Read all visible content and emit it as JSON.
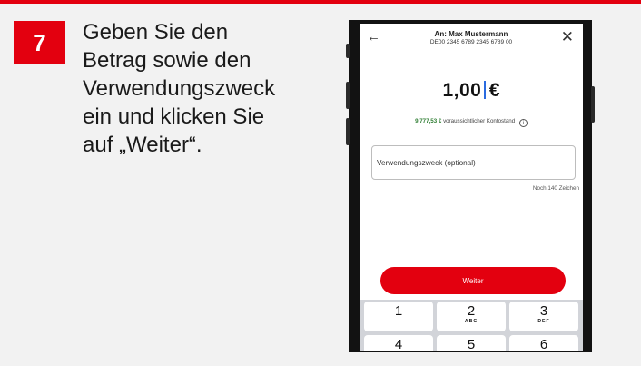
{
  "step": {
    "number": "7"
  },
  "instruction": {
    "lines": [
      "Geben Sie den",
      "Betrag sowie den",
      "Verwendungszweck",
      "ein und klicken Sie",
      "auf „Weiter“."
    ]
  },
  "phone": {
    "header": {
      "back_icon": "arrow-left-icon",
      "close_icon": "close-icon",
      "recipient": "An: Max Mustermann",
      "iban": "DE00 2345 6789 2345 6789 00"
    },
    "amount": {
      "value": "1,00",
      "currency": "€"
    },
    "balance": {
      "amount": "9.777,53 €",
      "label": "voraussichtlicher Kontostand",
      "info_icon": "info-icon"
    },
    "purpose_field": {
      "placeholder": "Verwendungszweck (optional)",
      "value": ""
    },
    "char_counter": "Noch 140 Zeichen",
    "continue_button": {
      "label": "Weiter"
    },
    "keypad": {
      "keys": [
        {
          "digit": "1",
          "letters": ""
        },
        {
          "digit": "2",
          "letters": "ABC"
        },
        {
          "digit": "3",
          "letters": "DEF"
        },
        {
          "digit": "4",
          "letters": ""
        },
        {
          "digit": "5",
          "letters": ""
        },
        {
          "digit": "6",
          "letters": ""
        }
      ]
    }
  },
  "colors": {
    "accent": "#e3000f",
    "background": "#f2f2f2",
    "positive": "#2e7d32"
  }
}
